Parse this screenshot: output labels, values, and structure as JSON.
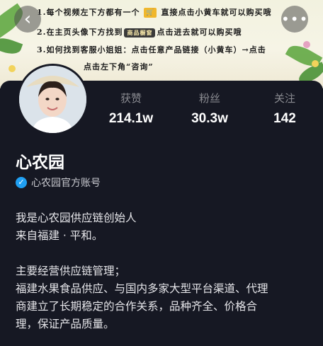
{
  "banner": {
    "line1_a": "1.每个视频左下方都有一个",
    "line1_b": "直接点击小黄车就可以购买哦",
    "line2_a": "2.在主页头像下方找到",
    "line2_badge": "商品橱窗",
    "line2_b": "点击进去就可以购买哦",
    "line3": "3.如何找到客服小姐姐：点击任意产品链接（小黄车）→点击",
    "line4": "点击左下角“咨询”"
  },
  "nav": {
    "back_glyph": "‹",
    "more_glyph": "•••"
  },
  "stats": [
    {
      "label": "获赞",
      "value": "214.1w"
    },
    {
      "label": "粉丝",
      "value": "30.3w"
    },
    {
      "label": "关注",
      "value": "142"
    }
  ],
  "profile": {
    "name": "心农园",
    "verified_text": "心农园官方账号"
  },
  "bio": [
    "我是心农园供应链创始人",
    "来自福建 · 平和。",
    "",
    "主要经营供应链管理；",
    "福建水果食品供应、与国内多家大型平台渠道、代理",
    "商建立了长期稳定的合作关系，品种齐全、价格合",
    "理，保证产品质量。"
  ],
  "colors": {
    "background": "#161823",
    "verify_blue": "#20a0f3",
    "label_gray": "#8a8b91"
  },
  "icons": [
    "back-icon",
    "more-icon",
    "cart-icon",
    "verified-icon"
  ]
}
